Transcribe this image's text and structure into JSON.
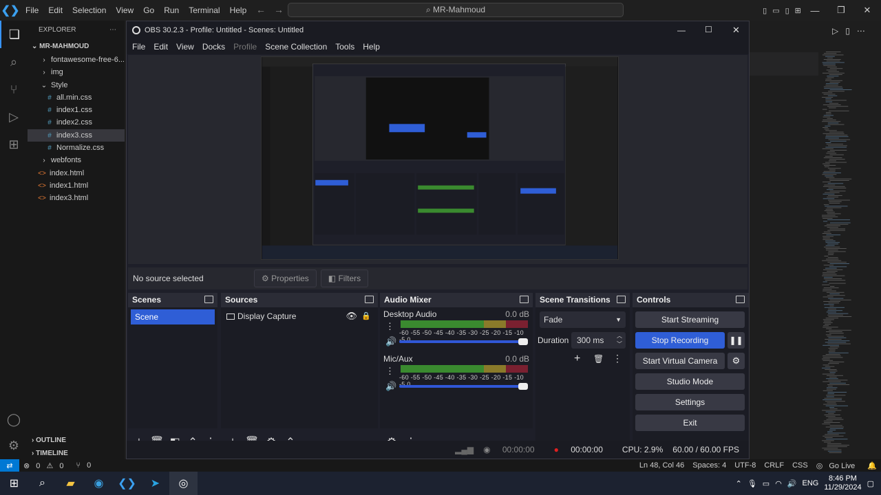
{
  "vscode": {
    "menu": [
      "File",
      "Edit",
      "Selection",
      "View",
      "Go",
      "Run",
      "Terminal",
      "Help"
    ],
    "search": "MR-Mahmoud",
    "explorer": {
      "header": "EXPLORER",
      "root": "MR-MAHMOUD",
      "items": [
        {
          "label": "fontawesome-free-6....",
          "type": "folder"
        },
        {
          "label": "img",
          "type": "folder"
        },
        {
          "label": "Style",
          "type": "folder-open"
        },
        {
          "label": "all.min.css",
          "type": "css"
        },
        {
          "label": "index1.css",
          "type": "css"
        },
        {
          "label": "index2.css",
          "type": "css"
        },
        {
          "label": "index3.css",
          "type": "css",
          "selected": true
        },
        {
          "label": "Normalize.css",
          "type": "css"
        },
        {
          "label": "webfonts",
          "type": "folder"
        },
        {
          "label": "index.html",
          "type": "html"
        },
        {
          "label": "index1.html",
          "type": "html"
        },
        {
          "label": "index3.html",
          "type": "html"
        }
      ],
      "outline": "OUTLINE",
      "timeline": "TIMELINE"
    },
    "status": {
      "errors": "0",
      "warnings": "0",
      "ports": "0",
      "position": "Ln 48, Col 46",
      "spaces": "Spaces: 4",
      "encoding": "UTF-8",
      "eol": "CRLF",
      "language": "CSS",
      "golive": "Go Live"
    }
  },
  "obs": {
    "title": "OBS 30.2.3 - Profile: Untitled - Scenes: Untitled",
    "menu": [
      "File",
      "Edit",
      "View",
      "Docks",
      "Profile",
      "Scene Collection",
      "Tools",
      "Help"
    ],
    "source_bar": {
      "no_source": "No source selected",
      "properties": "Properties",
      "filters": "Filters"
    },
    "docks": {
      "scenes": {
        "title": "Scenes",
        "items": [
          "Scene"
        ]
      },
      "sources": {
        "title": "Sources",
        "items": [
          "Display Capture"
        ]
      },
      "mixer": {
        "title": "Audio Mixer",
        "channels": [
          {
            "name": "Desktop Audio",
            "db": "0.0 dB"
          },
          {
            "name": "Mic/Aux",
            "db": "0.0 dB"
          }
        ],
        "scale": "-60 -55 -50 -45 -40 -35 -30 -25 -20 -15 -10 -5 0"
      },
      "transitions": {
        "title": "Scene Transitions",
        "transition": "Fade",
        "duration_label": "Duration",
        "duration": "300 ms"
      },
      "controls": {
        "title": "Controls",
        "start_streaming": "Start Streaming",
        "stop_recording": "Stop Recording",
        "start_virtual_camera": "Start Virtual Camera",
        "studio_mode": "Studio Mode",
        "settings": "Settings",
        "exit": "Exit"
      }
    },
    "status": {
      "stream_time": "00:00:00",
      "rec_time": "00:00:00",
      "cpu": "CPU: 2.9%",
      "fps": "60.00 / 60.00 FPS"
    }
  },
  "taskbar": {
    "lang": "ENG",
    "time": "8:46 PM",
    "date": "11/29/2024"
  }
}
